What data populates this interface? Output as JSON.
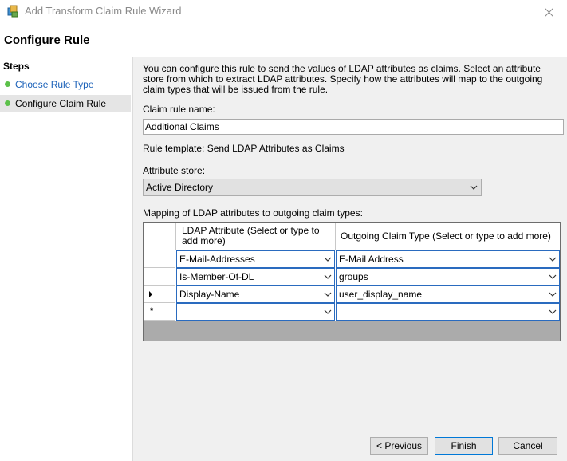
{
  "window": {
    "title": "Add Transform Claim Rule Wizard",
    "close_icon": "close-icon"
  },
  "page": {
    "title": "Configure Rule"
  },
  "sidebar": {
    "heading": "Steps",
    "items": [
      {
        "label": "Choose Rule Type",
        "status_color": "#5cc14a",
        "link_color": "#1c62b9"
      },
      {
        "label": "Configure Claim Rule",
        "status_color": "#5cc14a",
        "selected": true
      }
    ]
  },
  "main": {
    "description": "You can configure this rule to send the values of LDAP attributes as claims. Select an attribute store from which to extract LDAP attributes. Specify how the attributes will map to the outgoing claim types that will be issued from the rule.",
    "claim_rule_name_label": "Claim rule name:",
    "claim_rule_name_value": "Additional Claims",
    "rule_template": "Rule template: Send LDAP Attributes as Claims",
    "attribute_store_label": "Attribute store:",
    "attribute_store_value": "Active Directory",
    "mapping_label": "Mapping of LDAP attributes to outgoing claim types:",
    "grid": {
      "col1_header": "LDAP Attribute (Select or type to add more)",
      "col2_header": "Outgoing Claim Type (Select or type to add more)",
      "rows": [
        {
          "indicator": "",
          "ldap": "E-Mail-Addresses",
          "claim": "E-Mail Address"
        },
        {
          "indicator": "",
          "ldap": "Is-Member-Of-DL",
          "claim": "groups"
        },
        {
          "indicator": "▶",
          "ldap": "Display-Name",
          "claim": "user_display_name"
        },
        {
          "indicator": "*",
          "ldap": "",
          "claim": ""
        }
      ]
    }
  },
  "buttons": {
    "previous": "< Previous",
    "finish": "Finish",
    "cancel": "Cancel"
  }
}
